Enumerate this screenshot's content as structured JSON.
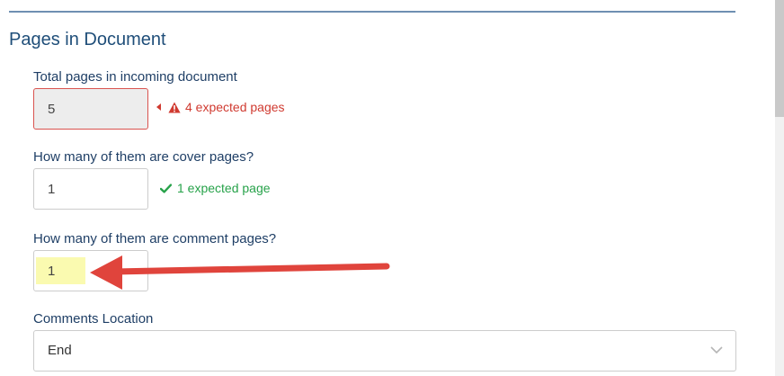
{
  "section": {
    "title": "Pages in Document"
  },
  "fields": {
    "total_pages": {
      "label": "Total pages in incoming document",
      "value": "5",
      "hint": "4 expected pages",
      "status": "error"
    },
    "cover_pages": {
      "label": "How many of them are cover pages?",
      "value": "1",
      "hint": "1 expected page",
      "status": "ok"
    },
    "comment_pages": {
      "label": "How many of them are comment pages?",
      "value": "1"
    },
    "comments_location": {
      "label": "Comments Location",
      "selected": "End"
    }
  },
  "icons": {
    "warning": "warning-triangle-icon",
    "check": "check-icon",
    "dropdown": "chevron-down-icon",
    "annotation": "red-arrow"
  },
  "colors": {
    "title": "#1f4e79",
    "label": "#1f3f66",
    "error": "#d03a30",
    "success": "#27a24a",
    "highlight": "#fafab0",
    "arrow": "#e0443c"
  }
}
